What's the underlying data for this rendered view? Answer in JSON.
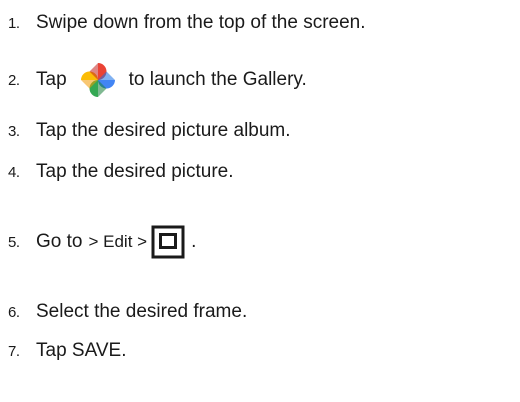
{
  "steps": [
    {
      "num": "1.",
      "text": "Swipe down from the top of the screen."
    },
    {
      "num": "2.",
      "before": "Tap",
      "icon": "google-photos-pinwheel-icon",
      "after": "to launch the Gallery."
    },
    {
      "num": "3.",
      "text": "Tap the desired picture album."
    },
    {
      "num": "4.",
      "text": "Tap the desired picture."
    },
    {
      "num": "5.",
      "before": "Go to",
      "mid": "> Edit >",
      "icon": "frame-square-icon",
      "after": "."
    },
    {
      "num": "6.",
      "text": "Select the desired frame."
    },
    {
      "num": "7.",
      "text": "Tap SAVE."
    }
  ],
  "colors": {
    "text": "#1a1a1a",
    "pinwheel_red": "#EA4335",
    "pinwheel_yellow": "#FBBC05",
    "pinwheel_green": "#34A853",
    "pinwheel_blue": "#4285F4"
  }
}
